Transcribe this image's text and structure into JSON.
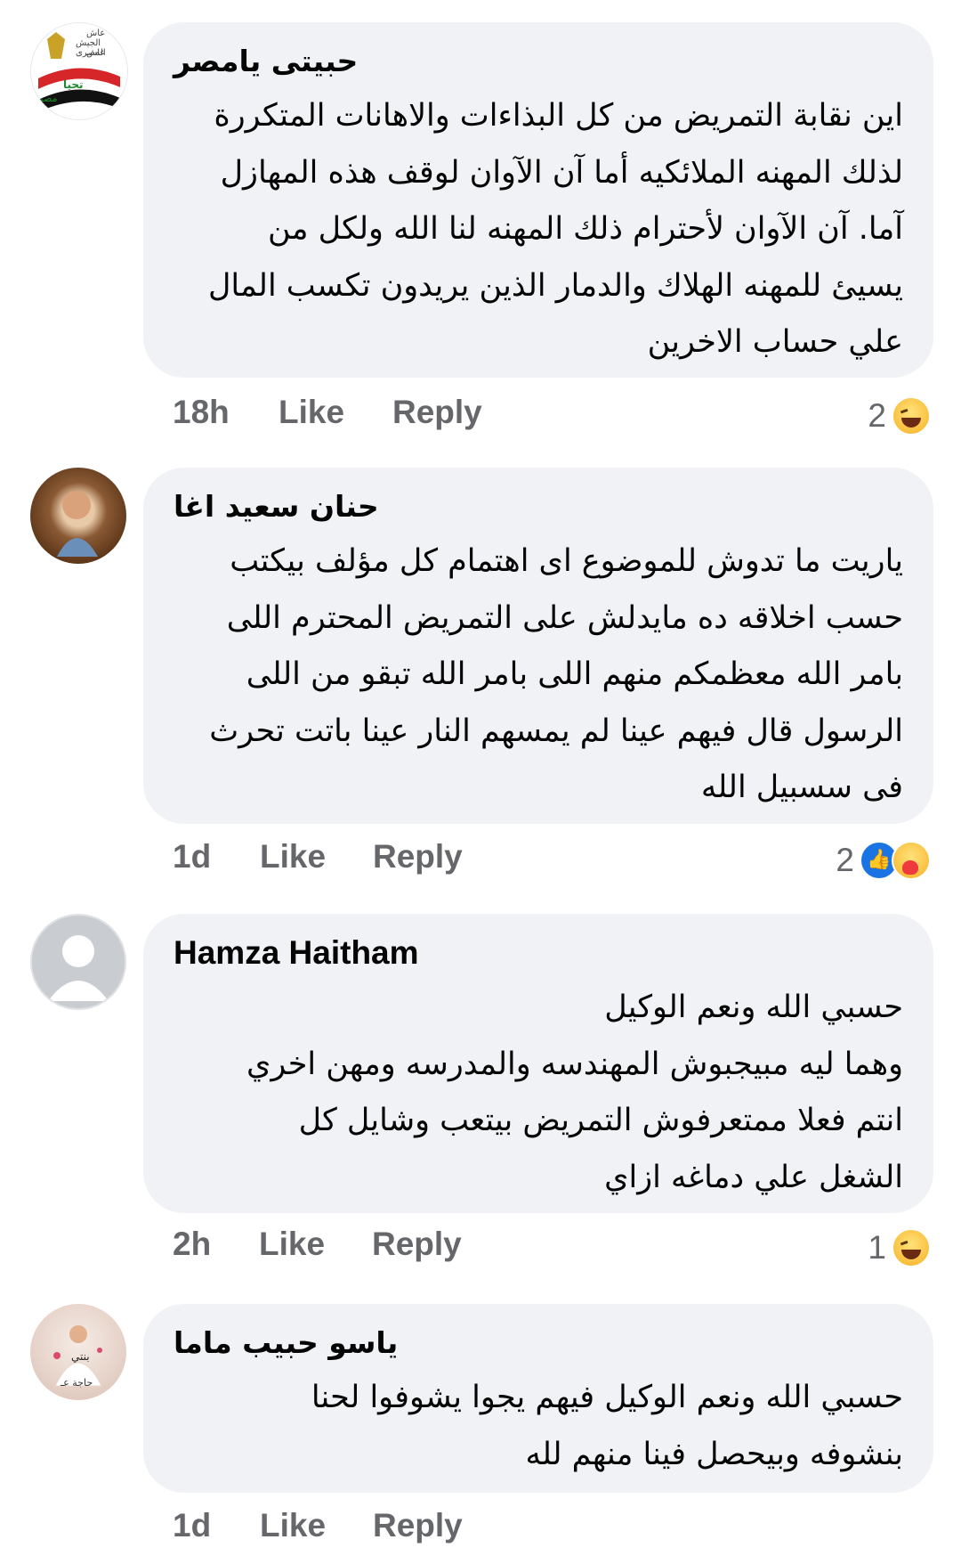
{
  "comments": [
    {
      "author": "حبيتى يامصر",
      "lines": [
        "اين نقابة التمريض من كل البذاءات والاهانات المتكررة",
        "لذلك المهنه الملائكيه أما آن الآوان لوقف هذه المهازل",
        "آما. آن الآوان لأحترام ذلك المهنه لنا الله ولكل من",
        "يسيئ للمهنه الهلاك والدمار الذين يريدون تكسب المال",
        "علي حساب الاخرين"
      ],
      "time": "18h",
      "like": "Like",
      "reply": "Reply",
      "reaction_count": "2",
      "reactions": [
        "haha"
      ],
      "avatar_text": [
        "عاش",
        "الجيش المصرى",
        "عاش",
        "تحيا",
        "مصر"
      ]
    },
    {
      "author": "حنان سعيد اغا",
      "lines": [
        "ياريت ما تدوش للموضوع اى اهتمام كل مؤلف بيكتب",
        "حسب اخلاقه ده مايدلش على التمريض المحترم اللى",
        "بامر الله معظمكم منهم اللى بامر الله تبقو من اللى",
        "الرسول قال فيهم عينا لم يمسهم النار عينا باتت تحرث",
        "فى سسبيل الله"
      ],
      "time": "1d",
      "like": "Like",
      "reply": "Reply",
      "reaction_count": "2",
      "reactions": [
        "like",
        "care"
      ]
    },
    {
      "author": "Hamza Haitham",
      "lines": [
        "حسبي الله ونعم الوكيل",
        "وهما ليه مبيجبوش المهندسه والمدرسه ومهن اخري",
        "انتم فعلا ممتعرفوش التمريض بيتعب وشايل كل",
        "الشغل علي دماغه ازاي"
      ],
      "time": "2h",
      "like": "Like",
      "reply": "Reply",
      "reaction_count": "1",
      "reactions": [
        "haha"
      ]
    },
    {
      "author": "ياسو حبيب ماما",
      "lines": [
        "حسبي الله ونعم الوكيل فيهم يجوا يشوفوا لحنا",
        "بنشوفه وبيحصل فينا منهم لله"
      ],
      "time": "1d",
      "like": "Like",
      "reply": "Reply",
      "avatar_text": [
        "بنتي",
        "حاجة عـ"
      ]
    }
  ]
}
